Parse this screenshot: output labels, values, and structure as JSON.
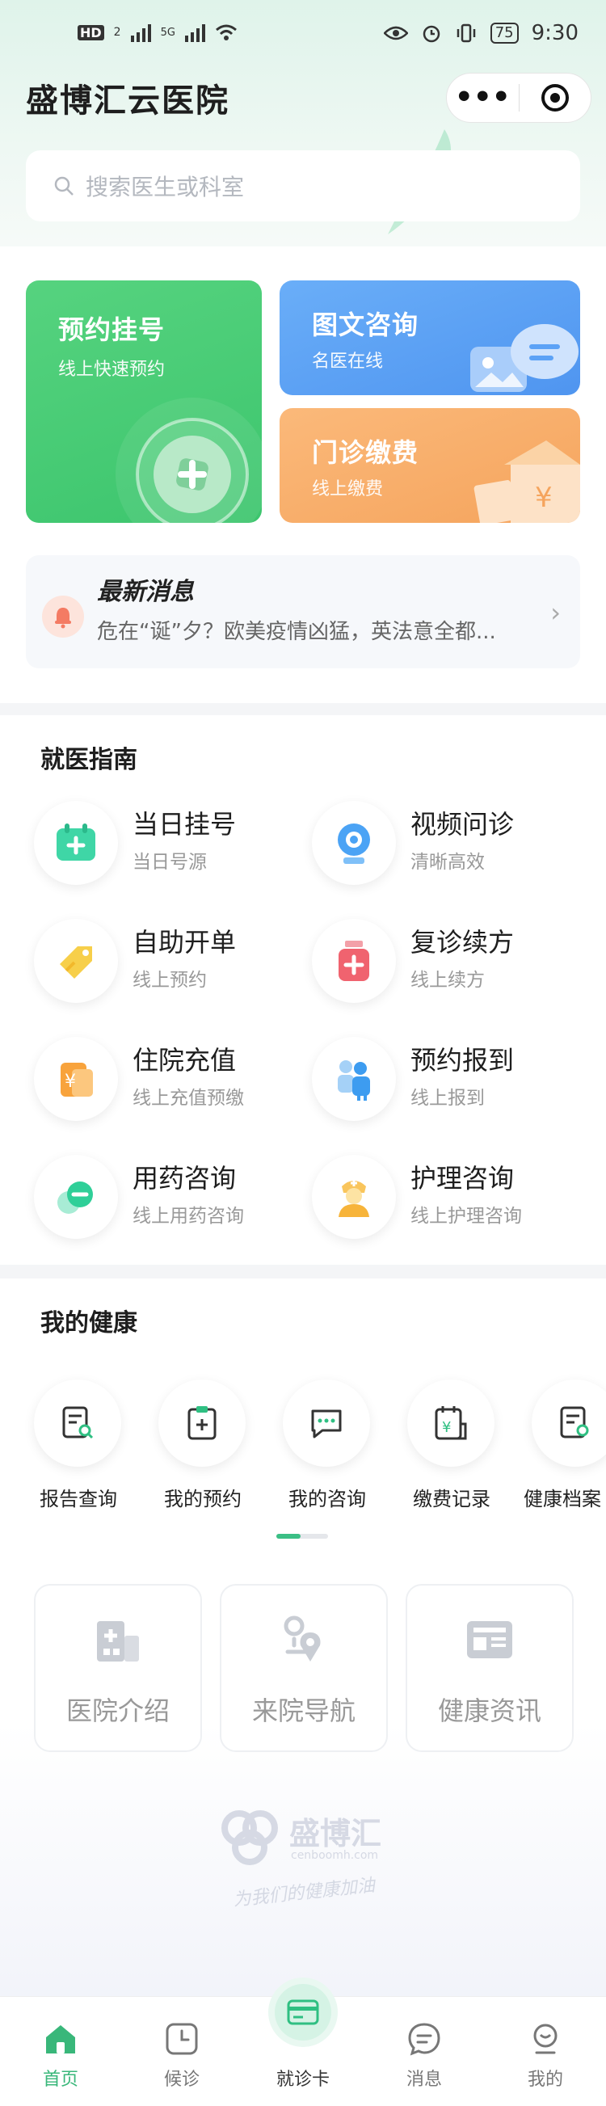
{
  "status_bar": {
    "time": "9:30",
    "battery": "75",
    "hd": "HD",
    "sim": "2",
    "net": "5G"
  },
  "header": {
    "app_title": "盛博汇云医院",
    "search_placeholder": "搜索医生或科室"
  },
  "quick_cards": {
    "appointment": {
      "title": "预约挂号",
      "subtitle": "线上快速预约"
    },
    "consult": {
      "title": "图文咨询",
      "subtitle": "名医在线"
    },
    "payment": {
      "title": "门诊缴费",
      "subtitle": "线上缴费"
    }
  },
  "news": {
    "title": "最新消息",
    "text": "危在“诞”夕？欧美疫情凶猛，英法意全都..."
  },
  "guide": {
    "title": "就医指南",
    "items": [
      {
        "title": "当日挂号",
        "subtitle": "当日号源",
        "icon": "calendar-plus-icon"
      },
      {
        "title": "视频问诊",
        "subtitle": "清晰高效",
        "icon": "webcam-icon"
      },
      {
        "title": "自助开单",
        "subtitle": "线上预约",
        "icon": "tag-icon"
      },
      {
        "title": "复诊续方",
        "subtitle": "线上续方",
        "icon": "medicine-bottle-icon"
      },
      {
        "title": "住院充值",
        "subtitle": "线上充值预缴",
        "icon": "yuan-wallet-icon"
      },
      {
        "title": "预约报到",
        "subtitle": "线上报到",
        "icon": "people-icon"
      },
      {
        "title": "用药咨询",
        "subtitle": "线上用药咨询",
        "icon": "pill-icon"
      },
      {
        "title": "护理咨询",
        "subtitle": "线上护理咨询",
        "icon": "nurse-icon"
      }
    ]
  },
  "health": {
    "title": "我的健康",
    "items": [
      {
        "label": "报告查询",
        "icon": "report-search-icon"
      },
      {
        "label": "我的预约",
        "icon": "clipboard-plus-icon"
      },
      {
        "label": "我的咨询",
        "icon": "chat-icon"
      },
      {
        "label": "缴费记录",
        "icon": "bill-icon"
      },
      {
        "label": "健康档案",
        "icon": "health-file-icon"
      }
    ],
    "scroll_progress": 0.47
  },
  "info_cards": [
    {
      "label": "医院介绍",
      "icon": "hospital-icon"
    },
    {
      "label": "来院导航",
      "icon": "location-icon"
    },
    {
      "label": "健康资讯",
      "icon": "news-icon"
    }
  ],
  "brand": {
    "name_cn": "盛博汇",
    "domain": "cenboomh.com",
    "slogan": "为我们的健康加油"
  },
  "tabbar": {
    "items": [
      {
        "label": "首页",
        "icon": "home-icon"
      },
      {
        "label": "候诊",
        "icon": "clock-icon"
      },
      {
        "label": "就诊卡",
        "icon": "card-icon"
      },
      {
        "label": "消息",
        "icon": "message-icon"
      },
      {
        "label": "我的",
        "icon": "user-icon"
      }
    ],
    "active_index": 0
  },
  "colors": {
    "accent": "#39b77a",
    "appointment": "#4ccd76",
    "consult": "#5ca2f6",
    "payment": "#f8ae6b"
  }
}
